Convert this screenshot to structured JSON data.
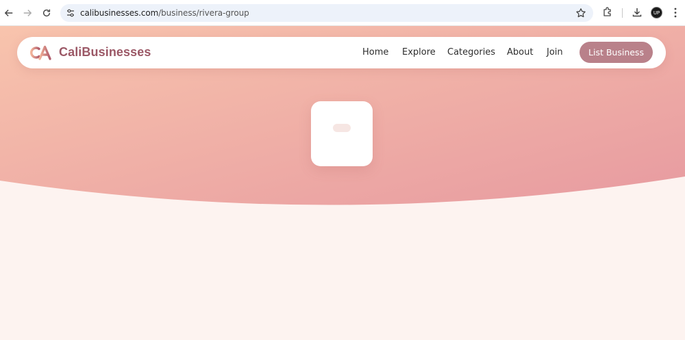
{
  "browser": {
    "url_domain": "calibusinesses.com",
    "url_path": "/business/rivera-group",
    "avatar_initials": "UP",
    "icons": [
      "back-icon",
      "forward-icon",
      "reload-icon",
      "site-settings-icon",
      "bookmark-star-icon",
      "extensions-icon",
      "download-icon",
      "menu-kebab-icon"
    ]
  },
  "site": {
    "brand": "CaliBusinesses",
    "nav": {
      "home": "Home",
      "explore": "Explore",
      "categories": "Categories",
      "about": "About",
      "join": "Join"
    },
    "cta_label": "List Business"
  },
  "colors": {
    "brand": "#9b5866",
    "cta": "#b9818a",
    "hero_start": "#f8c4ad",
    "hero_end": "#e79aa0",
    "page_bg": "#fdf3f0"
  }
}
